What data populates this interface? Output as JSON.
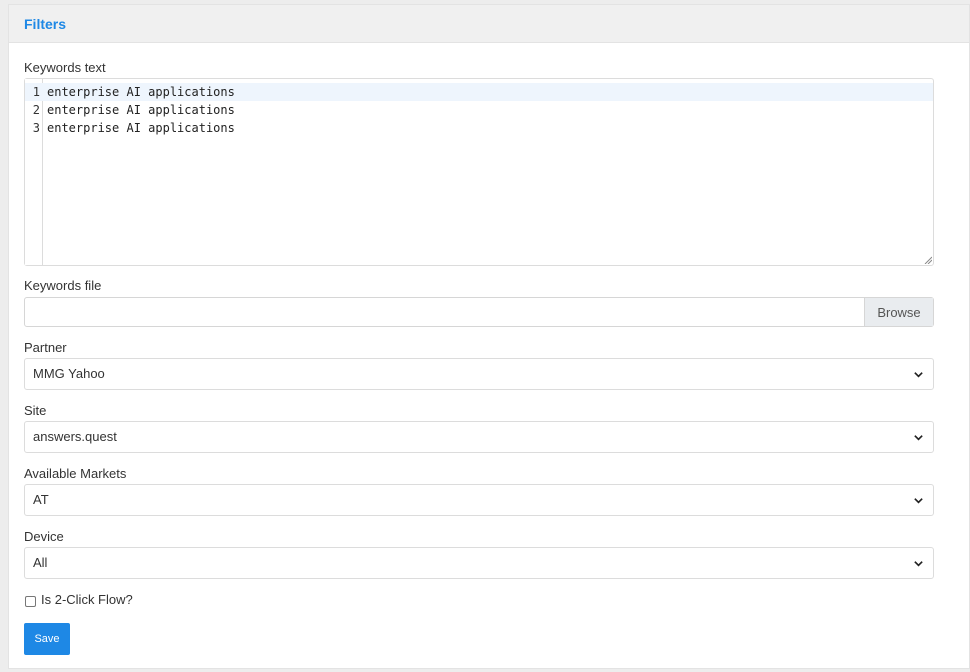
{
  "header": {
    "title": "Filters"
  },
  "keywords_text": {
    "label": "Keywords text",
    "lines": [
      {
        "number": "1",
        "text": "enterprise AI applications"
      },
      {
        "number": "2",
        "text": "enterprise AI applications"
      },
      {
        "number": "3",
        "text": "enterprise AI applications"
      }
    ]
  },
  "keywords_file": {
    "label": "Keywords file",
    "value": "",
    "browse_label": "Browse"
  },
  "partner": {
    "label": "Partner",
    "value": "MMG Yahoo"
  },
  "site": {
    "label": "Site",
    "value": "answers.quest"
  },
  "markets": {
    "label": "Available Markets",
    "value": "AT"
  },
  "device": {
    "label": "Device",
    "value": "All"
  },
  "two_click": {
    "label": "Is 2-Click Flow?",
    "checked": false
  },
  "save_label": "Save",
  "colors": {
    "accent": "#1e88e5",
    "header_bg": "#f0f0f0",
    "active_line": "#eef5fd"
  }
}
